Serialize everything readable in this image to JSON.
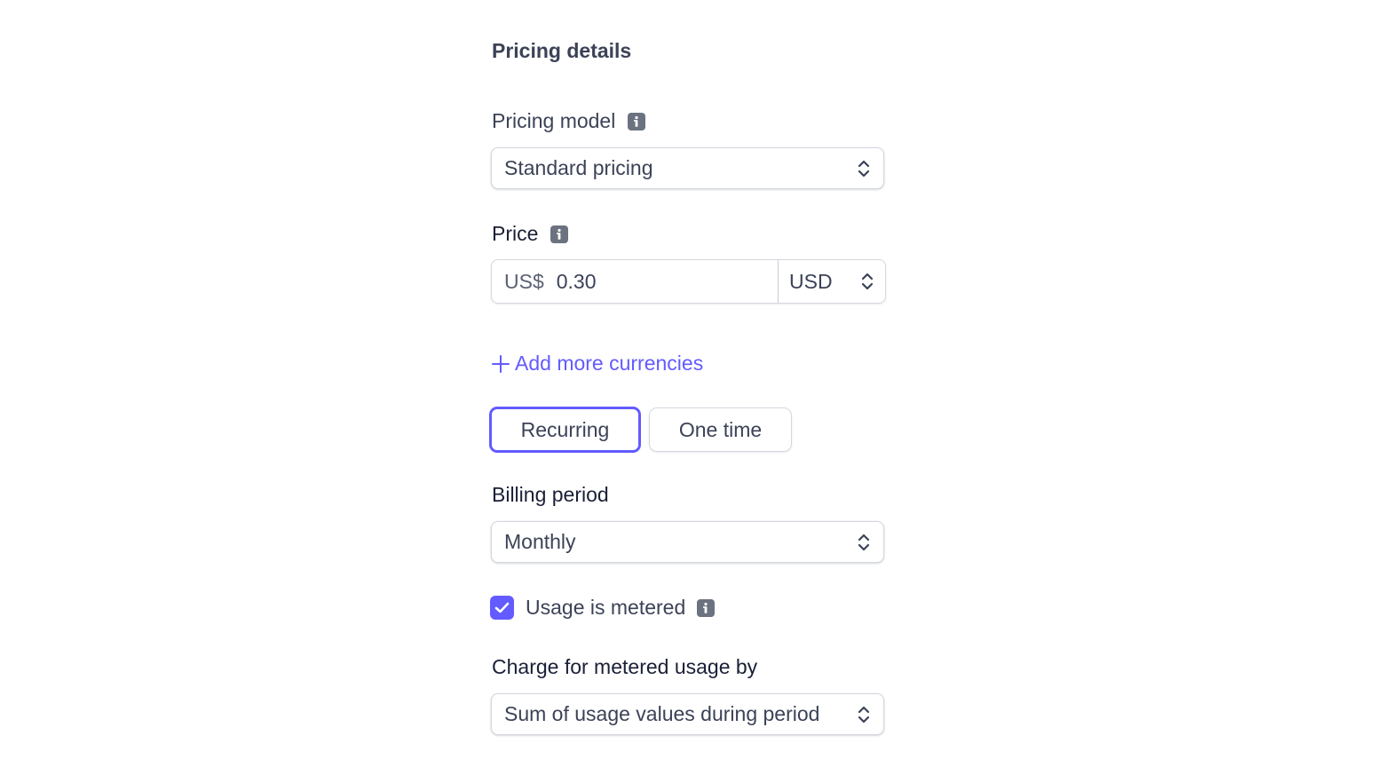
{
  "section": {
    "title": "Pricing details"
  },
  "pricing_model": {
    "label": "Pricing model",
    "info_icon": "info-icon",
    "selected": "Standard pricing"
  },
  "price": {
    "label": "Price",
    "info_icon": "info-icon",
    "currency_prefix": "US$",
    "amount": "0.30",
    "currency": "USD"
  },
  "add_currencies": {
    "icon": "plus-icon",
    "label": "Add more currencies"
  },
  "price_type": {
    "options": [
      "Recurring",
      "One time"
    ],
    "selected": "Recurring"
  },
  "billing_period": {
    "label": "Billing period",
    "selected": "Monthly"
  },
  "metered": {
    "label": "Usage is metered",
    "checked": true,
    "info_icon": "info-icon"
  },
  "metered_charge": {
    "label": "Charge for metered usage by",
    "selected": "Sum of usage values during period"
  },
  "colors": {
    "accent": "#635bff",
    "text": "#3c4257",
    "border": "#d5d8df",
    "info_icon": "#6b7280"
  }
}
